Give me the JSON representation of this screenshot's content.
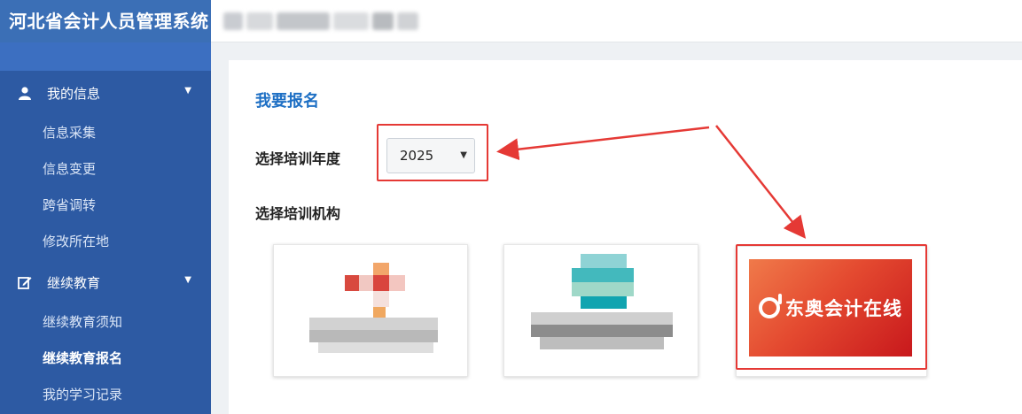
{
  "header": {
    "app_title": "河北省会计人员管理系统",
    "user_name_blurred": ""
  },
  "sidebar": {
    "groups": [
      {
        "label": "我的信息",
        "icon": "user-icon",
        "items": [
          "信息采集",
          "信息变更",
          "跨省调转",
          "修改所在地"
        ]
      },
      {
        "label": "继续教育",
        "icon": "edit-icon",
        "items": [
          "继续教育须知",
          "继续教育报名",
          "我的学习记录"
        ]
      }
    ],
    "active_item": "继续教育报名"
  },
  "main": {
    "section_title": "我要报名",
    "year_label": "选择培训年度",
    "year_value": "2025",
    "org_label": "选择培训机构",
    "org_cards": [
      {
        "name": "",
        "blurred": true
      },
      {
        "name": "",
        "blurred": true
      },
      {
        "name": "东奥会计在线",
        "blurred": false
      }
    ]
  },
  "colors": {
    "brand_bar": "#3b6fb6",
    "sidebar_bg": "#2d5aa3",
    "title_blue": "#1d6fc4",
    "highlight_red": "#e53935"
  }
}
